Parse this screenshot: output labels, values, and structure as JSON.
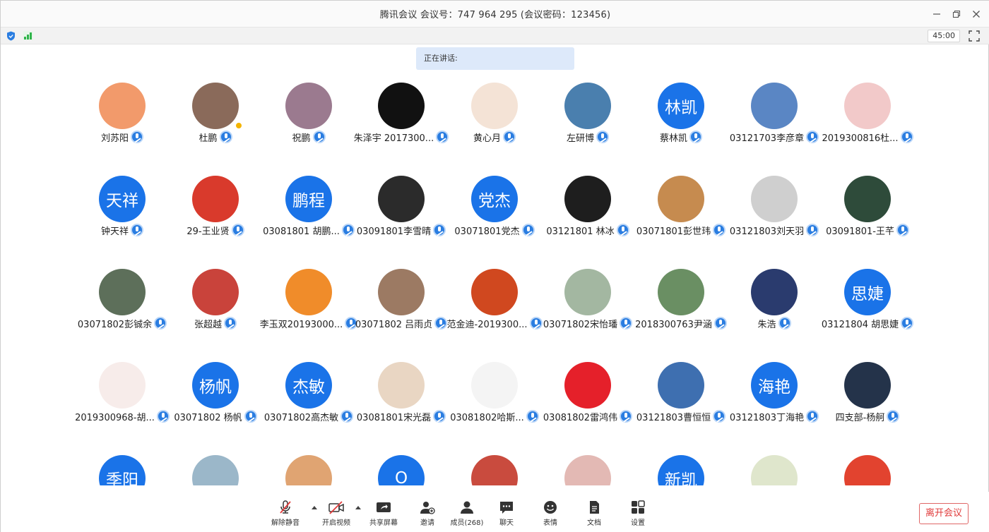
{
  "window": {
    "title": "腾讯会议 会议号：747 964 295  (会议密码：123456)",
    "controls": [
      "minimize",
      "restore",
      "close"
    ]
  },
  "statusbar": {
    "timer": "45:00",
    "icons": [
      "shield-icon",
      "signal-icon",
      "fullscreen-icon"
    ]
  },
  "speaking": {
    "label": "正在讲话:"
  },
  "participants": [
    {
      "name": "刘苏阳",
      "avatar_text": "",
      "avatar_color": "#f29a6b"
    },
    {
      "name": "杜鹏",
      "avatar_text": "",
      "avatar_color": "#8a6a5a",
      "host": true
    },
    {
      "name": "祝鹏",
      "avatar_text": "",
      "avatar_color": "#9b7a8f"
    },
    {
      "name": "朱泽宇 2017300...",
      "avatar_text": "",
      "avatar_color": "#111111"
    },
    {
      "name": "黄心月",
      "avatar_text": "",
      "avatar_color": "#f4e3d6"
    },
    {
      "name": "左研博",
      "avatar_text": "",
      "avatar_color": "#4a7fae"
    },
    {
      "name": "蔡林凯",
      "avatar_text": "林凯",
      "avatar_color": "#1a73e8"
    },
    {
      "name": "03121703李彦章",
      "avatar_text": "",
      "avatar_color": "#5a86c4"
    },
    {
      "name": "2019300816杜...",
      "avatar_text": "",
      "avatar_color": "#f2c9c9"
    },
    {
      "name": "钟天祥",
      "avatar_text": "天祥",
      "avatar_color": "#1a73e8"
    },
    {
      "name": "29-王业贤",
      "avatar_text": "",
      "avatar_color": "#d93a2c"
    },
    {
      "name": "03081801  胡鹏...",
      "avatar_text": "鹏程",
      "avatar_color": "#1a73e8"
    },
    {
      "name": "03091801李雪晴",
      "avatar_text": "",
      "avatar_color": "#2b2b2b"
    },
    {
      "name": "03071801党杰",
      "avatar_text": "党杰",
      "avatar_color": "#1a73e8"
    },
    {
      "name": "03121801 林冰",
      "avatar_text": "",
      "avatar_color": "#1e1e1e"
    },
    {
      "name": "03071801彭世玮",
      "avatar_text": "",
      "avatar_color": "#c68b4f"
    },
    {
      "name": "03121803刘天羽",
      "avatar_text": "",
      "avatar_color": "#cfcfcf"
    },
    {
      "name": "03091801-王芊",
      "avatar_text": "",
      "avatar_color": "#2e4b3a"
    },
    {
      "name": "03071802彭铖余",
      "avatar_text": "",
      "avatar_color": "#5d6f5a"
    },
    {
      "name": "张超越",
      "avatar_text": "",
      "avatar_color": "#c9433b"
    },
    {
      "name": "李玉双20193000...",
      "avatar_text": "",
      "avatar_color": "#f08c2a"
    },
    {
      "name": "03071802 吕雨贞",
      "avatar_text": "",
      "avatar_color": "#9c7a63"
    },
    {
      "name": "范金迪-2019300...",
      "avatar_text": "",
      "avatar_color": "#d0481f"
    },
    {
      "name": "03071802宋怡璠",
      "avatar_text": "",
      "avatar_color": "#a3b7a1"
    },
    {
      "name": "2018300763尹涵",
      "avatar_text": "",
      "avatar_color": "#6a8f63"
    },
    {
      "name": "朱浩",
      "avatar_text": "",
      "avatar_color": "#2a3b6e"
    },
    {
      "name": "03121804 胡思婕",
      "avatar_text": "思婕",
      "avatar_color": "#1a73e8"
    },
    {
      "name": "2019300968-胡...",
      "avatar_text": "",
      "avatar_color": "#f7ecea"
    },
    {
      "name": "03071802 杨帆",
      "avatar_text": "杨帆",
      "avatar_color": "#1a73e8"
    },
    {
      "name": "03071802高杰敏",
      "avatar_text": "杰敏",
      "avatar_color": "#1a73e8"
    },
    {
      "name": "03081801宋光磊",
      "avatar_text": "",
      "avatar_color": "#e9d6c3"
    },
    {
      "name": "03081802哈斯...",
      "avatar_text": "",
      "avatar_color": "#f4f4f4"
    },
    {
      "name": "03081802雷鸿伟",
      "avatar_text": "",
      "avatar_color": "#e5202a"
    },
    {
      "name": "03121803曹恒恒",
      "avatar_text": "",
      "avatar_color": "#3e6fb0"
    },
    {
      "name": "03121803丁海艳",
      "avatar_text": "海艳",
      "avatar_color": "#1a73e8"
    },
    {
      "name": "四支部-杨舸",
      "avatar_text": "",
      "avatar_color": "#24334a"
    },
    {
      "name": "",
      "avatar_text": "季阳",
      "avatar_color": "#1a73e8"
    },
    {
      "name": "",
      "avatar_text": "",
      "avatar_color": "#9bb7c9"
    },
    {
      "name": "",
      "avatar_text": "",
      "avatar_color": "#e0a472"
    },
    {
      "name": "",
      "avatar_text": "O",
      "avatar_color": "#1a73e8"
    },
    {
      "name": "",
      "avatar_text": "",
      "avatar_color": "#c94b3e"
    },
    {
      "name": "",
      "avatar_text": "",
      "avatar_color": "#e3b9b4"
    },
    {
      "name": "",
      "avatar_text": "新凯",
      "avatar_color": "#1a73e8"
    },
    {
      "name": "",
      "avatar_text": "",
      "avatar_color": "#dfe6cc"
    },
    {
      "name": "",
      "avatar_text": "",
      "avatar_color": "#e2432f"
    }
  ],
  "toolbar": {
    "unmute": "解除静音",
    "video": "开启视频",
    "share": "共享屏幕",
    "invite": "邀请",
    "members": "成员(268)",
    "chat": "聊天",
    "reactions": "表情",
    "docs": "文档",
    "settings": "设置",
    "leave": "离开会议"
  },
  "colors": {
    "accent": "#1a73e8",
    "speaking_bg": "#dde9fa",
    "leave": "#e03a3a"
  }
}
